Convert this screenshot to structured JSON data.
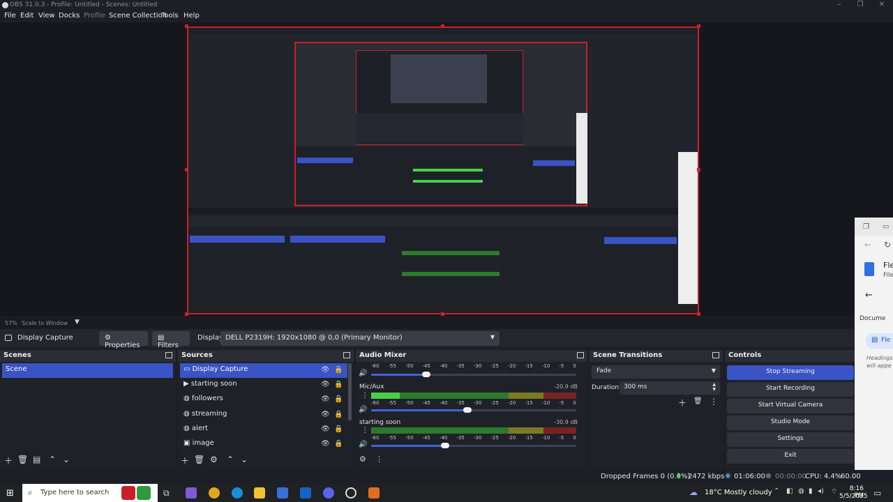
{
  "window": {
    "title": "OBS 31.0.3 - Profile: Untitled - Scenes: Untitled"
  },
  "menu": [
    "File",
    "Edit",
    "View",
    "Docks",
    "Profile",
    "Scene Collection",
    "Tools",
    "Help"
  ],
  "zoom": {
    "percent": "57%",
    "mode": "Scale to Window"
  },
  "context": {
    "source_name": "Display Capture",
    "properties_label": "Properties",
    "filters_label": "Filters",
    "display_label": "Display",
    "display_value": "DELL P2319H: 1920x1080 @ 0,0 (Primary Monitor)"
  },
  "scenes": {
    "title": "Scenes",
    "items": [
      "Scene"
    ]
  },
  "sources": {
    "title": "Sources",
    "items": [
      {
        "name": "Display Capture",
        "icon": "monitor-icon"
      },
      {
        "name": "starting soon",
        "icon": "play-icon"
      },
      {
        "name": "followers",
        "icon": "globe-icon"
      },
      {
        "name": "streaming",
        "icon": "globe-icon"
      },
      {
        "name": "alert",
        "icon": "globe-icon"
      },
      {
        "name": "image",
        "icon": "image-icon"
      }
    ]
  },
  "audio": {
    "title": "Audio Mixer",
    "ticks": [
      "-60",
      "-55",
      "-50",
      "-45",
      "-40",
      "-35",
      "-30",
      "-25",
      "-20",
      "-15",
      "-10",
      "-5",
      "0"
    ],
    "channels": [
      {
        "name": "",
        "db": "",
        "level": 0.0,
        "volume": 0.27
      },
      {
        "name": "Mic/Aux",
        "db": "-20.9 dB",
        "level": 0.14,
        "volume": 0.47
      },
      {
        "name": "starting soon",
        "db": "-30.9 dB",
        "level": 0.0,
        "volume": 0.36
      }
    ]
  },
  "transitions": {
    "title": "Scene Transitions",
    "type": "Fade",
    "duration_label": "Duration",
    "duration_value": "300 ms"
  },
  "controls": {
    "title": "Controls",
    "buttons": [
      "Stop Streaming",
      "Start Recording",
      "Start Virtual Camera",
      "Studio Mode",
      "Settings",
      "Exit"
    ]
  },
  "status": {
    "dropped_frames": "Dropped Frames 0 (0.0%)",
    "bitrate": "2472 kbps",
    "stream_time": "01:06:00",
    "rec_time": "00:00:00",
    "cpu": "CPU: 4.4%",
    "fps": "60.00"
  },
  "taskbar": {
    "search_placeholder": "Type here to search",
    "weather": "18°C  Mostly cloudy",
    "time": "8:16 PM",
    "date": "5/5/2025"
  },
  "side_window": {
    "title": "Fle",
    "subtitle": "File",
    "docs": "Docume",
    "item": "Fle",
    "note": "Headings will appe"
  },
  "colors": {
    "accent": "#3a53c5",
    "selection_border": "#c8202a",
    "meter_green": "#48d048"
  }
}
